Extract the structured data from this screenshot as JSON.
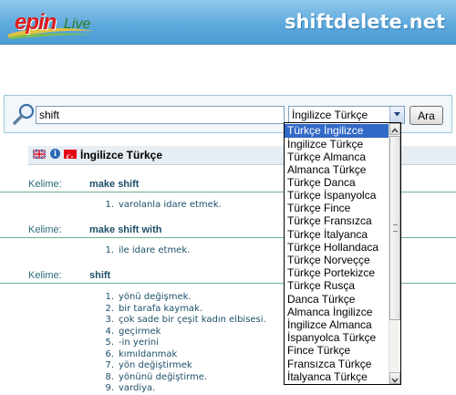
{
  "header": {
    "logo_brand": "epin",
    "logo_suffix": "Live",
    "site_name": "shiftdelete.net"
  },
  "search": {
    "query": "shift",
    "selected_language": "İngilizce Türkçe",
    "button_label": "Ara"
  },
  "results": {
    "title": "İngilizce Türkçe",
    "kelime_label": "Kelime:",
    "entries": [
      {
        "word": "make shift",
        "definitions": [
          {
            "num": "1.",
            "text": "varolanla idare etmek."
          }
        ]
      },
      {
        "word": "make shift with",
        "definitions": [
          {
            "num": "1.",
            "text": "ile idare etmek."
          }
        ]
      },
      {
        "word": "shift",
        "definitions": [
          {
            "num": "1.",
            "text": "yönü değişmek."
          },
          {
            "num": "2.",
            "text": "bir tarafa kaymak."
          },
          {
            "num": "3.",
            "text": "çok sade bir çeşit kadın elbisesi."
          },
          {
            "num": "4.",
            "text": "geçirmek"
          },
          {
            "num": "5.",
            "text": "-in yerini"
          },
          {
            "num": "6.",
            "text": "kımıldanmak"
          },
          {
            "num": "7.",
            "text": "yön değiştirmek"
          },
          {
            "num": "8.",
            "text": "yönünü değiştirme."
          },
          {
            "num": "9.",
            "text": "vardiya."
          }
        ]
      }
    ]
  },
  "dropdown": {
    "options": [
      "Türkçe İngilizce",
      "İngilizce Türkçe",
      "Türkçe Almanca",
      "Almanca Türkçe",
      "Türkçe Danca",
      "Türkçe İspanyolca",
      "Türkçe Fince",
      "Türkçe Fransızca",
      "Türkçe İtalyanca",
      "Türkçe Hollandaca",
      "Türkçe Norveççe",
      "Türkçe Portekizce",
      "Türkçe Rusça",
      "Danca Türkçe",
      "Almanca İngilizce",
      "İngilizce Almanca",
      "İspanyolca Türkçe",
      "Fince Türkçe",
      "Fransızca Türkçe",
      "İtalyanca Türkçe"
    ],
    "highlighted_index": 0
  },
  "colors": {
    "header_blue": "#5ba8dc",
    "highlight": "#3169c6",
    "rule_green": "#6bb38d",
    "text_teal": "#1c4f69"
  },
  "icons": {
    "search": "magnifier-icon",
    "uk_flag": "uk-flag-icon",
    "tr_flag": "turkey-flag-icon",
    "info": "info-icon"
  }
}
